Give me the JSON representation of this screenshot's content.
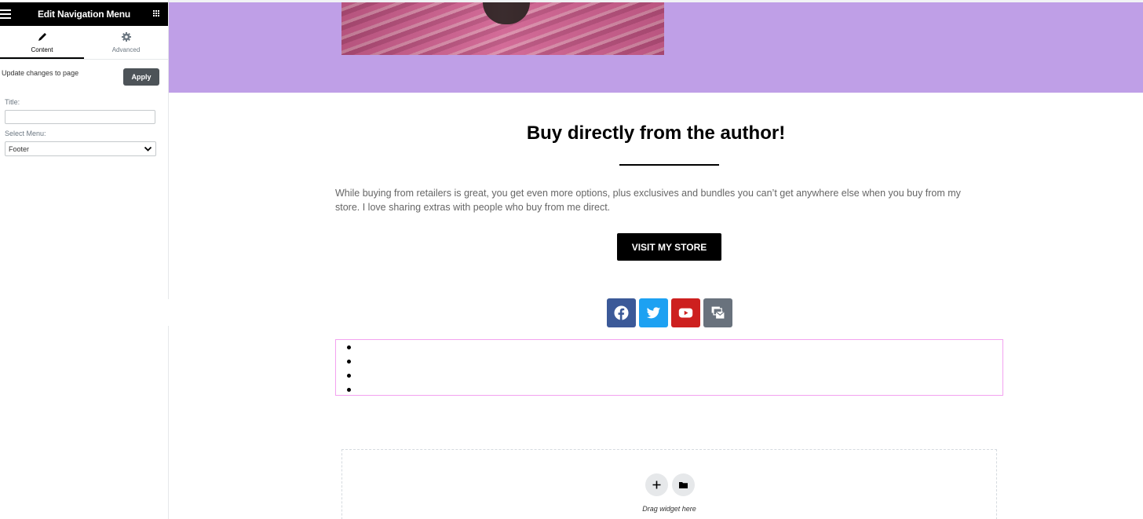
{
  "panel": {
    "title": "Edit Navigation Menu",
    "icons": {
      "menu": "hamburger-icon",
      "widgets": "grid-icon"
    },
    "tabs": [
      {
        "label": "Content",
        "icon": "pencil-icon",
        "active": true
      },
      {
        "label": "Advanced",
        "icon": "gear-icon",
        "active": false
      }
    ],
    "update_text": "Update changes to page",
    "apply_label": "Apply",
    "title_label": "Title:",
    "title_value": "",
    "select_label": "Select Menu:",
    "select_value": "Footer"
  },
  "preview": {
    "hero_color": "#bf9fe7",
    "heading": "Buy directly from the author!",
    "paragraph": "While buying from retailers is great, you get even more options, plus exclusives and bundles you can’t get anywhere else when you buy from my store. I love sharing extras with people who buy from me direct.",
    "store_button": "VISIT MY STORE",
    "social": [
      {
        "name": "facebook",
        "icon": "facebook-icon",
        "color": "#3b5998"
      },
      {
        "name": "twitter",
        "icon": "twitter-icon",
        "color": "#1da1f2"
      },
      {
        "name": "youtube",
        "icon": "youtube-icon",
        "color": "#cd201f"
      },
      {
        "name": "contact",
        "icon": "mail-bulk-icon",
        "color": "#69727d"
      }
    ],
    "nav_items_count": 4,
    "drop_hint": "Drag widget here"
  }
}
